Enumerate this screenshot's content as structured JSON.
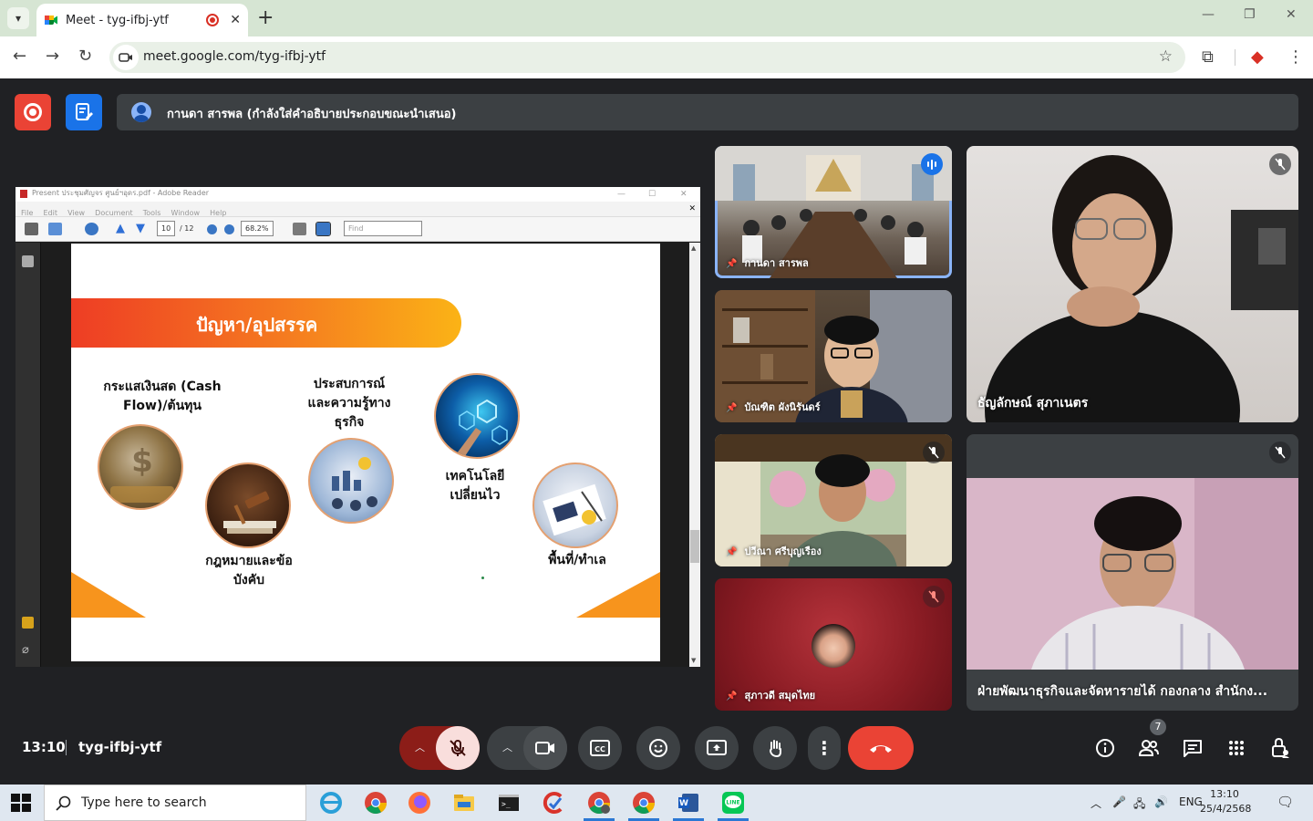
{
  "browser": {
    "tab_title": "Meet - tyg-ifbj-ytf",
    "new_tab": "+",
    "url": "meet.google.com/tyg-ifbj-ytf"
  },
  "meet": {
    "presenter_banner": "กานดา สารพล (กำลังใส่คำอธิบายประกอบขณะนำเสนอ)",
    "clock": "13:10",
    "meeting_code": "tyg-ifbj-ytf",
    "participant_count": "7",
    "participants": [
      {
        "name": "กานดา สารพล"
      },
      {
        "name": "ธัญลักษณ์ สุภาเนตร"
      },
      {
        "name": "บัณฑิต ผังนิรันดร์"
      },
      {
        "name": "ปวีณา ศรีบุญเรือง"
      },
      {
        "name": "สุภาวดี สมุดไทย"
      },
      {
        "name": "ฝ่ายพัฒนาธุรกิจและจัดหารายได้ กองกลาง สำนักง..."
      }
    ]
  },
  "reader": {
    "window_title": "Present ประชุมศัญจร ศูนย์ฯอุดร.pdf - Adobe Reader",
    "menu": [
      "File",
      "Edit",
      "View",
      "Document",
      "Tools",
      "Window",
      "Help"
    ],
    "page_current": "10",
    "page_total": "/ 12",
    "zoom": "68.2%",
    "find_placeholder": "Find"
  },
  "slide": {
    "title": "ปัญหา/อุปสรรค",
    "items": [
      {
        "label_line1": "กระแสเงินสด (Cash",
        "label_line2": "Flow)/ต้นทุน"
      },
      {
        "label_line1": "กฎหมายและข้อ",
        "label_line2": "บังคับ"
      },
      {
        "label_line1": "ประสบการณ์",
        "label_line2": "และความรู้ทาง",
        "label_line3": "ธุรกิจ"
      },
      {
        "label_line1": "เทคโนโลยี",
        "label_line2": "เปลี่ยนไว"
      },
      {
        "label_line1": "พื้นที่/ทำเล"
      }
    ]
  },
  "taskbar": {
    "search_placeholder": "Type here to search",
    "language": "ENG",
    "time": "13:10",
    "date": "25/4/2568"
  },
  "colors": {
    "meet_bg": "#202124",
    "surface": "#3c4043",
    "hangup_red": "#ea4335",
    "active_blue": "#8ab4f8",
    "slide_orange": "#f57b20"
  }
}
